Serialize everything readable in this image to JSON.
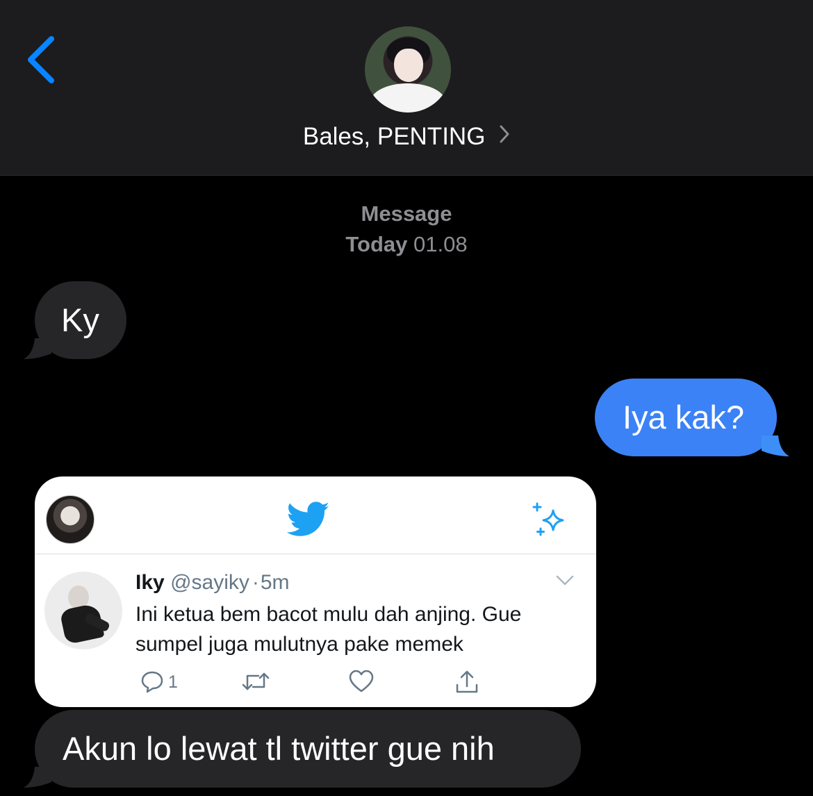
{
  "header": {
    "back_label": "Back",
    "contact_name": "Bales, PENTING",
    "contact_icon": "chevron-right-icon"
  },
  "thread": {
    "label": "Message",
    "day": "Today",
    "time": "01.08"
  },
  "messages": [
    {
      "direction": "incoming",
      "text": "Ky"
    },
    {
      "direction": "outgoing",
      "text": "Iya kak?"
    },
    {
      "direction": "incoming",
      "text": "Akun lo lewat tl twitter gue nih"
    }
  ],
  "tweet": {
    "author_name": "Iky",
    "handle": "@sayiky",
    "separator": "·",
    "time_ago": "5m",
    "text": "Ini ketua bem bacot mulu dah anjing. Gue sumpel juga mulutnya pake memek",
    "reply_count": "1",
    "icons": [
      "twitter-bird-icon",
      "sparkle-icon",
      "chevron-down-icon",
      "reply-icon",
      "retweet-icon",
      "like-icon",
      "share-icon"
    ]
  },
  "colors": {
    "header_bg": "#1c1c1e",
    "incoming_bubble": "#262628",
    "outgoing_bubble": "#3e8ef7",
    "ios_blue": "#0a84ff",
    "twitter_blue": "#1da1f2",
    "muted_text": "#8e8e93"
  }
}
